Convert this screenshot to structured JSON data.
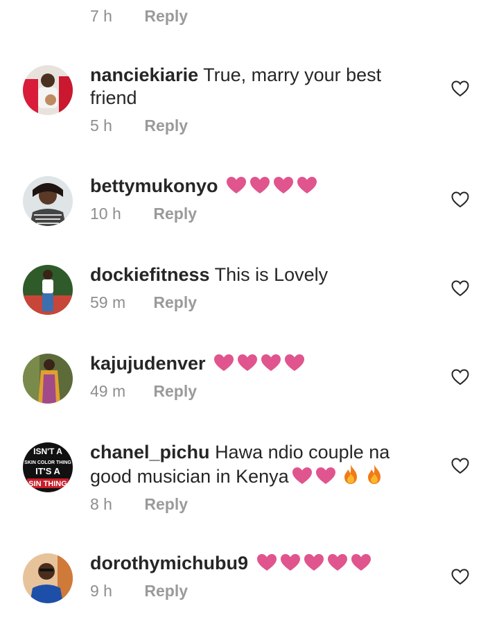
{
  "top": {
    "time": "7 h",
    "reply": "Reply"
  },
  "comments": [
    {
      "username": "nanciekiarie",
      "text_line1": "True, marry your best",
      "text_line2": "friend",
      "time": "5 h",
      "reply": "Reply"
    },
    {
      "username": "bettymukonyo",
      "hearts": 4,
      "time": "10 h",
      "reply": "Reply"
    },
    {
      "username": "dockiefitness",
      "text": "This is Lovely",
      "time": "59 m",
      "reply": "Reply"
    },
    {
      "username": "kajujudenver",
      "hearts": 4,
      "time": "49 m",
      "reply": "Reply"
    },
    {
      "username": "chanel_pichu",
      "text_line1": "Hawa ndio couple na",
      "text_line2": "good musician in Kenya",
      "time": "8 h",
      "reply": "Reply",
      "avatar_text": [
        "ISN'T A",
        "SKIN COLOR THING",
        "IT'S A",
        "SIN THING"
      ]
    },
    {
      "username": "dorothymichubu9",
      "hearts": 5,
      "time": "9 h",
      "reply": "Reply"
    }
  ],
  "colors": {
    "heart": "#e0558e",
    "text": "#262626",
    "meta": "#8e8e8e"
  },
  "icons": {
    "heart_emoji": "heart-icon",
    "fire_emoji": "fire-icon",
    "like": "heart-outline-icon"
  }
}
